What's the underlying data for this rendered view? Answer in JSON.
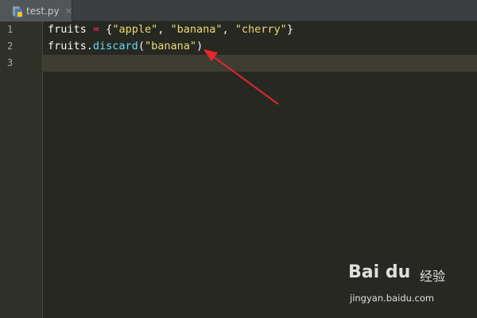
{
  "tab": {
    "filename": "test.py",
    "close_symbol": "×",
    "icon": "python-file-icon"
  },
  "editor": {
    "line_numbers": [
      "1",
      "2",
      "3"
    ],
    "lines": [
      {
        "tokens": [
          {
            "text": "fruits ",
            "kind": "id"
          },
          {
            "text": "=",
            "kind": "op"
          },
          {
            "text": " {",
            "kind": "punct"
          },
          {
            "text": "\"apple\"",
            "kind": "str"
          },
          {
            "text": ", ",
            "kind": "punct"
          },
          {
            "text": "\"banana\"",
            "kind": "str"
          },
          {
            "text": ", ",
            "kind": "punct"
          },
          {
            "text": "\"cherry\"",
            "kind": "str"
          },
          {
            "text": "}",
            "kind": "punct"
          }
        ]
      },
      {
        "tokens": [
          {
            "text": "fruits.",
            "kind": "id"
          },
          {
            "text": "discard",
            "kind": "fn"
          },
          {
            "text": "(",
            "kind": "punct"
          },
          {
            "text": "\"banana\"",
            "kind": "str"
          },
          {
            "text": ")",
            "kind": "punct"
          }
        ]
      },
      {
        "tokens": []
      }
    ],
    "current_line": "3"
  },
  "annotation": {
    "arrow_color": "#e8262c",
    "icon": "red-arrow-icon"
  },
  "watermark": {
    "brand": "Bai du",
    "cn_text": "经验",
    "url": "jingyan.baidu.com"
  },
  "colors": {
    "background": "#272822",
    "string": "#e6db74",
    "operator": "#f92672",
    "function": "#66d9ef",
    "text": "#f8f8f2"
  }
}
